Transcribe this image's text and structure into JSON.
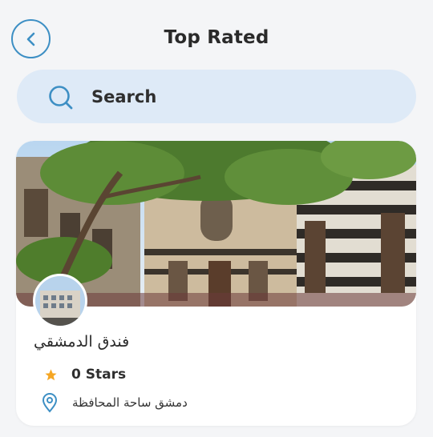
{
  "header": {
    "title": "Top Rated",
    "back_icon": "chevron-left-icon"
  },
  "search": {
    "placeholder": "Search",
    "icon": "search-icon"
  },
  "hotel": {
    "name": "فندق الدمشقي",
    "rating_label": "0 Stars",
    "location": "دمشق ساحة المحافظة",
    "star_color": "#f5a623",
    "location_icon_color": "#3d8fc4"
  },
  "colors": {
    "accent": "#3d8fc4",
    "search_bg": "#deeaf7",
    "page_bg": "#f4f5f7"
  }
}
